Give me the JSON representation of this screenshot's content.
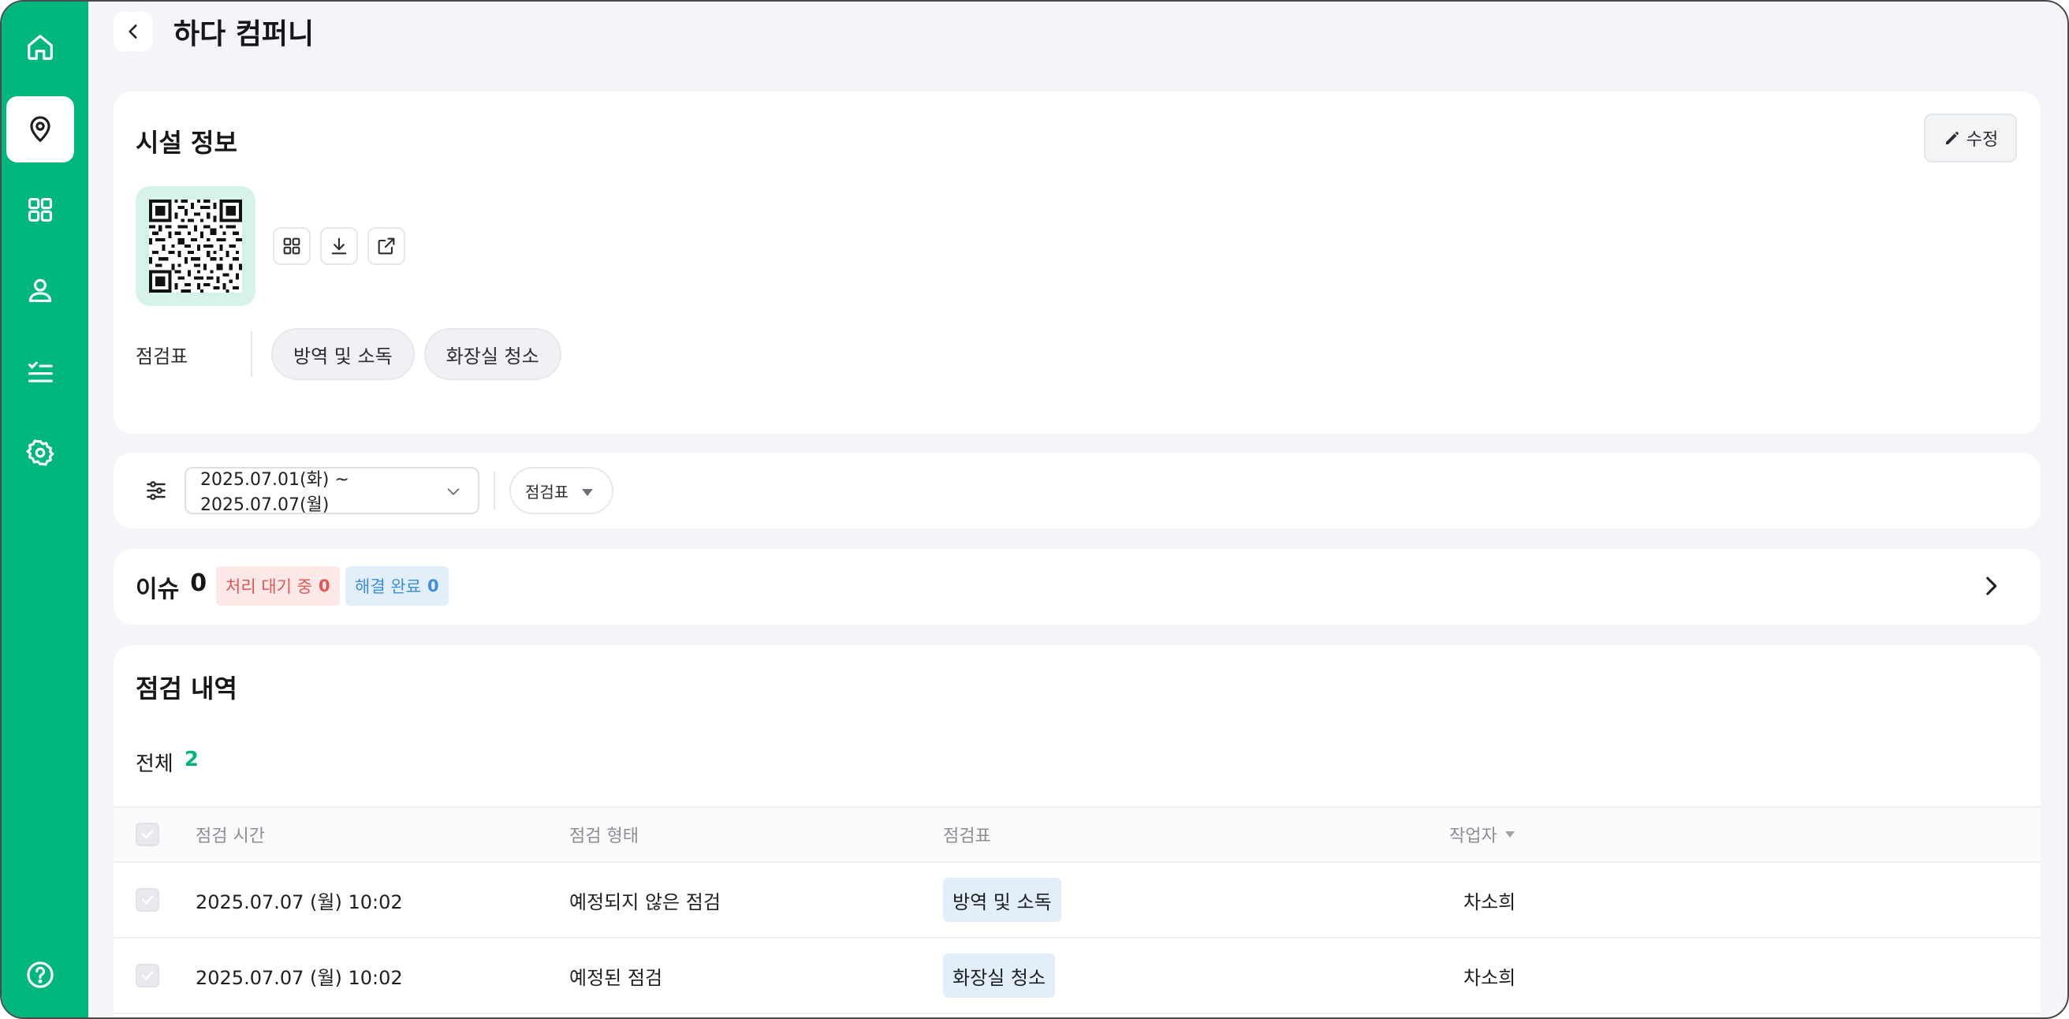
{
  "colors": {
    "brand": "#00b67f",
    "pending": "#e65454",
    "done": "#3a8fe0"
  },
  "sidebar": {
    "items": [
      {
        "icon": "home-icon"
      },
      {
        "icon": "location-pin-icon",
        "active": true
      },
      {
        "icon": "grid-icon"
      },
      {
        "icon": "user-icon"
      },
      {
        "icon": "checklist-icon"
      },
      {
        "icon": "gear-icon"
      },
      {
        "icon": "help-icon"
      }
    ]
  },
  "header": {
    "title": "하다 컴퍼니"
  },
  "facility": {
    "title": "시설 정보",
    "edit_label": "수정",
    "checklist_label": "점검표",
    "checklists": [
      "방역 및 소독",
      "화장실 청소"
    ]
  },
  "filter": {
    "date_range": "2025.07.01(화) ~ 2025.07.07(월)",
    "checklist_filter": "점검표"
  },
  "issues": {
    "title": "이슈",
    "count": "0",
    "pending_label": "처리 대기 중",
    "pending_count": "0",
    "done_label": "해결 완료",
    "done_count": "0"
  },
  "history": {
    "title": "점검 내역",
    "total_label": "전체",
    "total_count": "2",
    "columns": [
      "점검 시간",
      "점검 형태",
      "점검표",
      "작업자"
    ],
    "rows": [
      {
        "time": "2025.07.07 (월) 10:02",
        "type": "예정되지 않은 점검",
        "checklist": "방역 및 소독",
        "worker": "차소희"
      },
      {
        "time": "2025.07.07 (월) 10:02",
        "type": "예정된 점검",
        "checklist": "화장실 청소",
        "worker": "차소희"
      }
    ]
  }
}
